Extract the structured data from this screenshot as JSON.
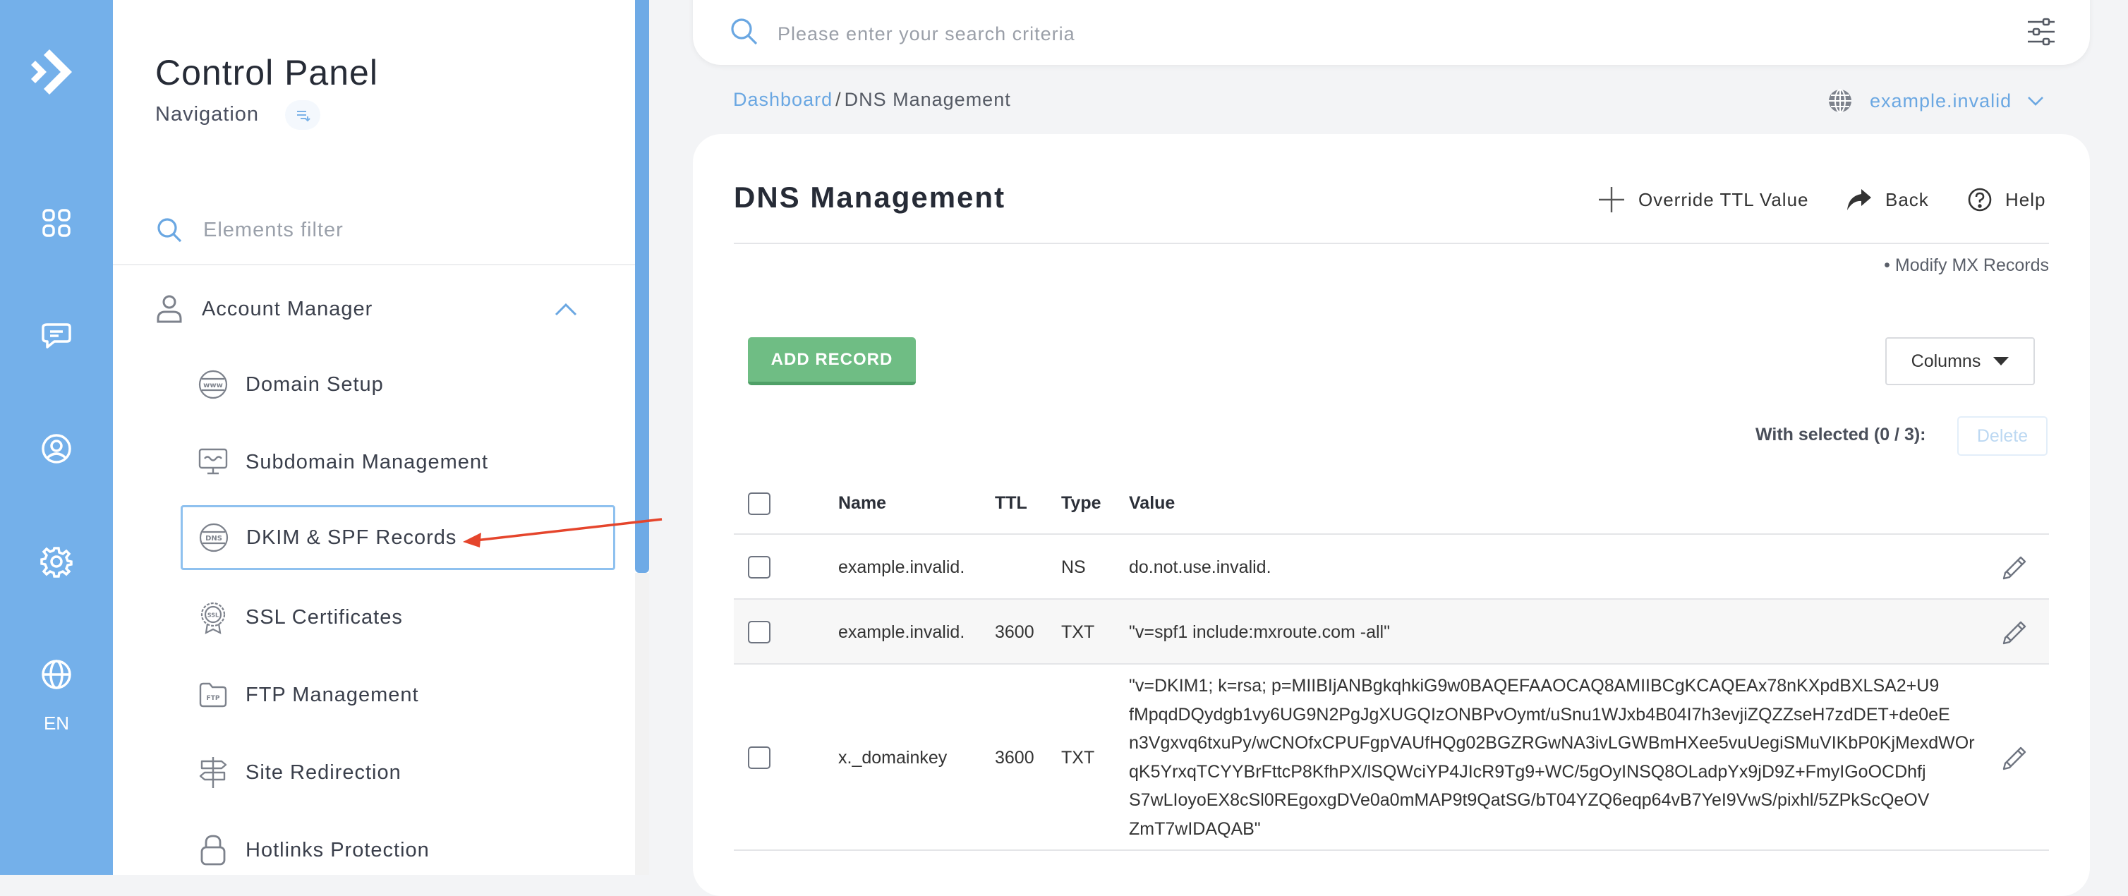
{
  "rail": {
    "icons": [
      "logo-arrow-icon",
      "grid-icon",
      "chat-icon",
      "user-circle-icon",
      "gear-icon",
      "globe-icon"
    ],
    "lang": "EN"
  },
  "nav": {
    "title": "Control Panel",
    "subtitle": "Navigation",
    "filter_placeholder": "Elements filter",
    "group": {
      "label": "Account Manager",
      "expanded": true
    },
    "items": [
      {
        "label": "Domain Setup",
        "icon": "www-globe-icon"
      },
      {
        "label": "Subdomain Management",
        "icon": "subdomain-monitor-icon"
      },
      {
        "label": "DKIM & SPF Records",
        "icon": "dns-globe-icon",
        "active": true
      },
      {
        "label": "SSL Certificates",
        "icon": "ssl-badge-icon"
      },
      {
        "label": "FTP Management",
        "icon": "ftp-folder-icon"
      },
      {
        "label": "Site Redirection",
        "icon": "signpost-icon"
      },
      {
        "label": "Hotlinks Protection",
        "icon": "lock-icon"
      }
    ]
  },
  "search": {
    "placeholder": "Please enter your search criteria"
  },
  "breadcrumb": {
    "home": "Dashboard",
    "separator": "/",
    "current": "DNS Management"
  },
  "domain_selector": {
    "value": "example.invalid"
  },
  "page": {
    "title": "DNS Management",
    "actions": {
      "override_ttl": "Override TTL Value",
      "back": "Back",
      "help": "Help"
    },
    "modify_mx": "• Modify MX Records",
    "add_record": "ADD RECORD",
    "columns": "Columns",
    "with_selected": "With selected (0 / 3):",
    "delete": "Delete"
  },
  "table": {
    "headers": {
      "name": "Name",
      "ttl": "TTL",
      "type": "Type",
      "value": "Value"
    },
    "rows": [
      {
        "name": "example.invalid.",
        "ttl": "",
        "type": "NS",
        "value": "do.not.use.invalid."
      },
      {
        "name": "example.invalid.",
        "ttl": "3600",
        "type": "TXT",
        "value": "\"v=spf1 include:mxroute.com -all\""
      },
      {
        "name": "x._domainkey",
        "ttl": "3600",
        "type": "TXT",
        "value_lines": [
          "\"v=DKIM1; k=rsa; p=MIIBIjANBgkqhkiG9w0BAQEFAAOCAQ8AMIIBCgKCAQEAx78nKXpdBXLSA2+U9",
          "fMpqdDQydgb1vy6UG9N2PgJgXUGQIzONBPvOymt/uSnu1WJxb4B04I7h3evjiZQZZseH7zdDET+de0eE",
          "n3Vgxvq6txuPy/wCNOfxCPUFgpVAUfHQg02BGZRGwNA3ivLGWBmHXee5vuUegiSMuVIKbP0KjMexdWOr",
          "qK5YrxqTCYYBrFttcP8KfhPX/lSQWciYP4JIcR9Tg9+WC/5gOyINSQ8OLadpYx9jD9Z+FmyIGoOCDhfj",
          "S7wLIoyoEX8cSl0REgoxgDVe0a0mMAP9t9QatSG/bT04YZQ6eqp64vB7YeI9VwS/pixhl/5ZPkScQeOV",
          "ZmT7wIDAQAB\""
        ]
      }
    ]
  },
  "colors": {
    "rail_bg": "#74b0ea",
    "accent_link": "#6aa7e2",
    "add_button": "#6fbd84",
    "annotation_arrow": "#e5452c"
  }
}
